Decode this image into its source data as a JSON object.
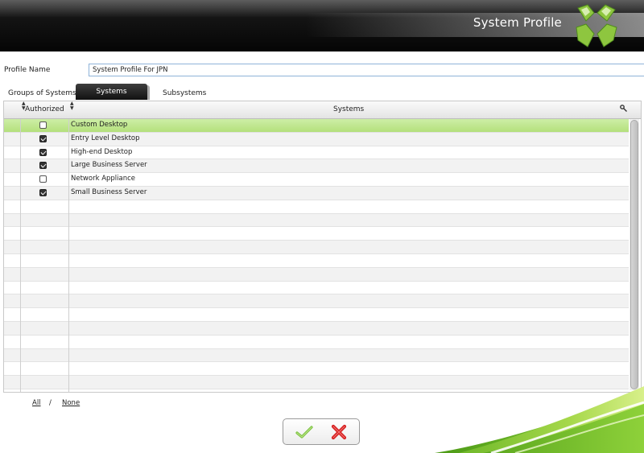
{
  "header": {
    "title": "System Profile"
  },
  "profile": {
    "label": "Profile Name",
    "value": "System Profile For JPN"
  },
  "tabs": [
    {
      "label": "Groups of Systems",
      "active": false
    },
    {
      "label": "Systems",
      "active": true
    },
    {
      "label": "Subsystems",
      "active": false
    }
  ],
  "table": {
    "columns": [
      "Authorized",
      "Systems"
    ],
    "rows": [
      {
        "name": "Custom Desktop",
        "authorized": false,
        "selected": true
      },
      {
        "name": "Entry Level Desktop",
        "authorized": true,
        "selected": false
      },
      {
        "name": "High-end Desktop",
        "authorized": true,
        "selected": false
      },
      {
        "name": "Large Business Server",
        "authorized": true,
        "selected": false
      },
      {
        "name": "Network Appliance",
        "authorized": false,
        "selected": false
      },
      {
        "name": "Small Business Server",
        "authorized": true,
        "selected": false
      }
    ]
  },
  "selection_links": {
    "all": "All",
    "separator": "/",
    "none": "None"
  },
  "icons": {
    "logo": "logo-icon",
    "search": "key-icon",
    "ok": "checkmark-icon",
    "cancel": "cross-icon"
  },
  "colors": {
    "accent": "#7cc242",
    "selected_row": "#b4e07c",
    "header_bg": "#111111"
  }
}
